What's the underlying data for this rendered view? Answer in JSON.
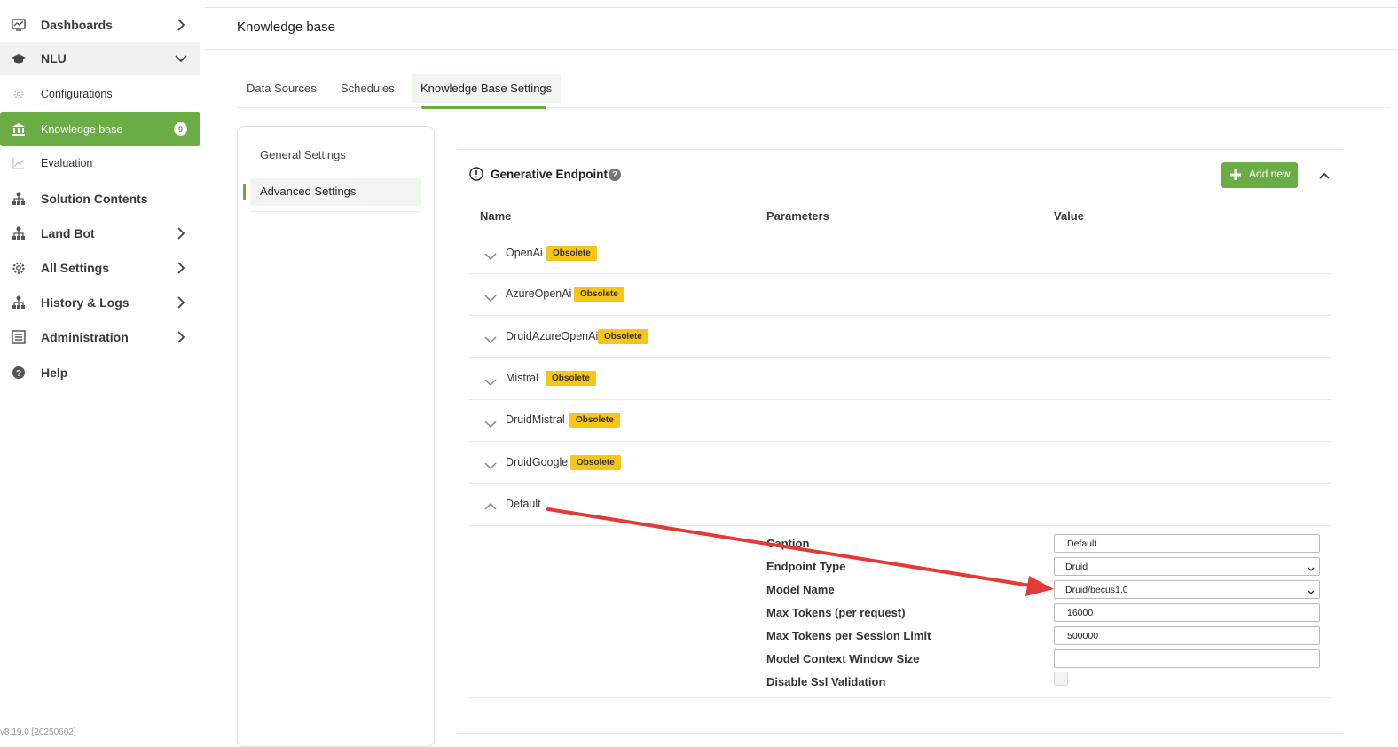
{
  "sidebar": {
    "items": [
      {
        "label": "Dashboards",
        "icon": "chart-icon"
      },
      {
        "label": "NLU",
        "icon": "graduation-cap-icon"
      },
      {
        "label": "Configurations",
        "icon": "gear-icon"
      },
      {
        "label": "Knowledge base",
        "icon": "bank-icon",
        "badge": "9"
      },
      {
        "label": "Evaluation",
        "icon": "chart-line-icon"
      },
      {
        "label": "Solution Contents",
        "icon": "sitemap-icon"
      },
      {
        "label": "Land Bot",
        "icon": "sitemap-icon"
      },
      {
        "label": "All Settings",
        "icon": "gear-icon"
      },
      {
        "label": "History & Logs",
        "icon": "sitemap-icon"
      },
      {
        "label": "Administration",
        "icon": "list-icon"
      },
      {
        "label": "Help",
        "icon": "question-circle-icon"
      }
    ],
    "version": "v8.19.0 [20250602]"
  },
  "header": {
    "title": "Knowledge base"
  },
  "tabs": [
    {
      "label": "Data Sources"
    },
    {
      "label": "Schedules"
    },
    {
      "label": "Knowledge Base Settings"
    }
  ],
  "settings_nav": {
    "general": "General Settings",
    "advanced": "Advanced Settings"
  },
  "section": {
    "title": "Generative Endpoints",
    "help": "?",
    "add_button": "Add new"
  },
  "table": {
    "columns": [
      "Name",
      "Parameters",
      "Value"
    ],
    "rows": [
      {
        "name": "OpenAi",
        "badge": "Obsolete"
      },
      {
        "name": "AzureOpenAi",
        "badge": "Obsolete"
      },
      {
        "name": "DruidAzureOpenAi",
        "badge": "Obsolete"
      },
      {
        "name": "Mistral",
        "badge": "Obsolete"
      },
      {
        "name": "DruidMistral",
        "badge": "Obsolete"
      },
      {
        "name": "DruidGoogle",
        "badge": "Obsolete"
      },
      {
        "name": "Default",
        "badge": ""
      }
    ]
  },
  "params": {
    "caption": {
      "label": "Caption",
      "value": "Default"
    },
    "endpoint_type": {
      "label": "Endpoint Type",
      "value": "Druid"
    },
    "model_name": {
      "label": "Model Name",
      "value": "Druid/becus1.0"
    },
    "max_tokens": {
      "label": "Max Tokens (per request)",
      "value": "16000"
    },
    "max_tokens_session": {
      "label": "Max Tokens per Session Limit",
      "value": "500000"
    },
    "context_window": {
      "label": "Model Context Window Size",
      "value": ""
    },
    "disable_ssl": {
      "label": "Disable Ssl Validation",
      "checked": false
    }
  },
  "colors": {
    "accent": "#6aad45",
    "obsolete_badge": "#f5c518",
    "arrow": "#e53935"
  }
}
